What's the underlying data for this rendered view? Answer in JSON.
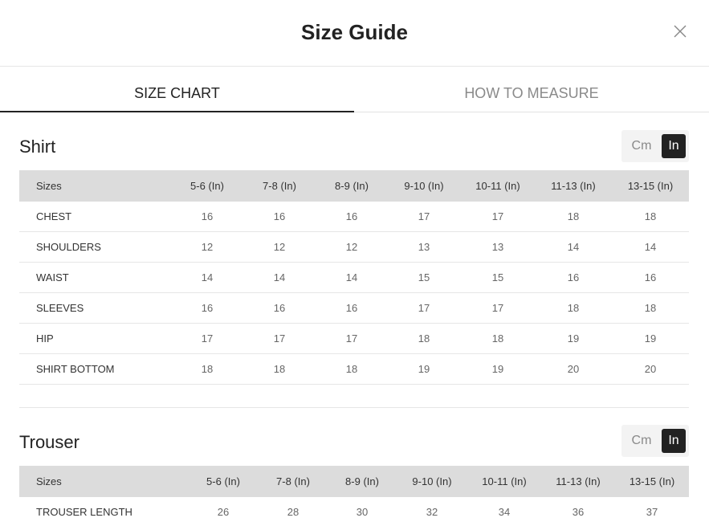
{
  "modal": {
    "title": "Size Guide"
  },
  "tabs": [
    {
      "label": "SIZE CHART",
      "active": true
    },
    {
      "label": "HOW TO MEASURE",
      "active": false
    }
  ],
  "unit_toggle": {
    "options": [
      "Cm",
      "In"
    ],
    "selected": "In"
  },
  "shirt": {
    "title": "Shirt",
    "headers": [
      "Sizes",
      "5-6 (In)",
      "7-8 (In)",
      "8-9 (In)",
      "9-10 (In)",
      "10-11 (In)",
      "11-13 (In)",
      "13-15 (In)"
    ],
    "rows": [
      {
        "label": "CHEST",
        "values": [
          "16",
          "16",
          "16",
          "17",
          "17",
          "18",
          "18"
        ]
      },
      {
        "label": "SHOULDERS",
        "values": [
          "12",
          "12",
          "12",
          "13",
          "13",
          "14",
          "14"
        ]
      },
      {
        "label": "WAIST",
        "values": [
          "14",
          "14",
          "14",
          "15",
          "15",
          "16",
          "16"
        ]
      },
      {
        "label": "SLEEVES",
        "values": [
          "16",
          "16",
          "16",
          "17",
          "17",
          "18",
          "18"
        ]
      },
      {
        "label": "HIP",
        "values": [
          "17",
          "17",
          "17",
          "18",
          "18",
          "19",
          "19"
        ]
      },
      {
        "label": "SHIRT BOTTOM",
        "values": [
          "18",
          "18",
          "18",
          "19",
          "19",
          "20",
          "20"
        ]
      }
    ]
  },
  "trouser": {
    "title": "Trouser",
    "headers": [
      "Sizes",
      "5-6 (In)",
      "7-8 (In)",
      "8-9 (In)",
      "9-10 (In)",
      "10-11 (In)",
      "11-13 (In)",
      "13-15 (In)"
    ],
    "rows": [
      {
        "label": "TROUSER LENGTH",
        "values": [
          "26",
          "28",
          "30",
          "32",
          "34",
          "36",
          "37"
        ]
      }
    ]
  },
  "colors": {
    "accent": "#222222",
    "header_bg": "#dcdcdc",
    "toggle_bg": "#f3f3f3",
    "muted_text": "#8a8a8a"
  },
  "icons": {
    "close": "close-icon"
  }
}
